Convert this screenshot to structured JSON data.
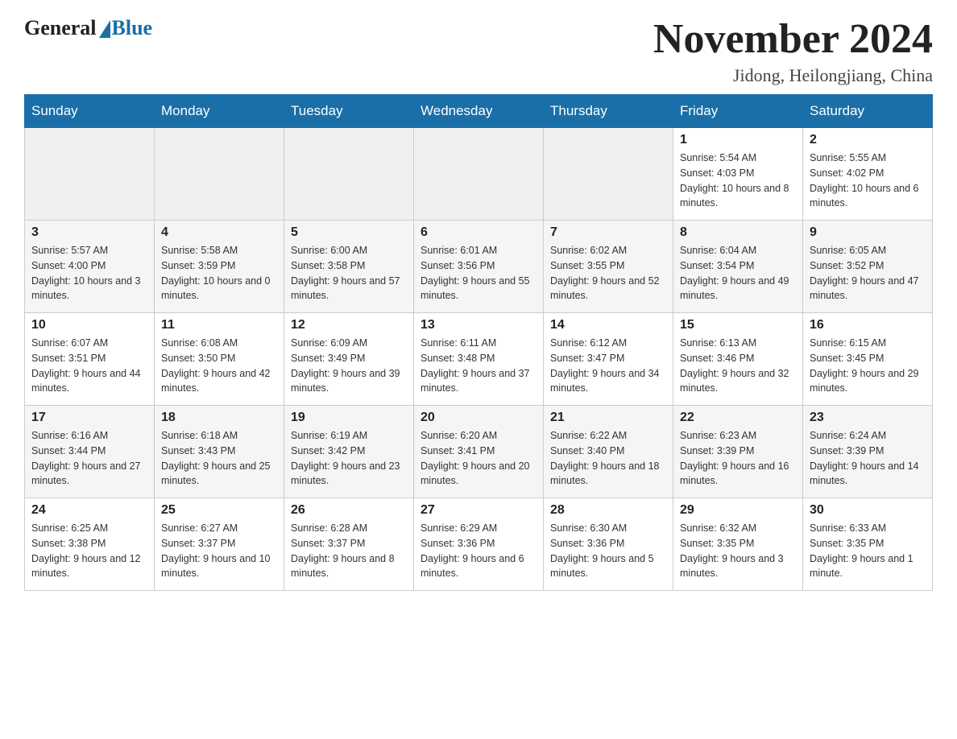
{
  "header": {
    "logo_general": "General",
    "logo_blue": "Blue",
    "month_title": "November 2024",
    "location": "Jidong, Heilongjiang, China"
  },
  "days_of_week": [
    "Sunday",
    "Monday",
    "Tuesday",
    "Wednesday",
    "Thursday",
    "Friday",
    "Saturday"
  ],
  "weeks": [
    [
      {
        "day": "",
        "sunrise": "",
        "sunset": "",
        "daylight": ""
      },
      {
        "day": "",
        "sunrise": "",
        "sunset": "",
        "daylight": ""
      },
      {
        "day": "",
        "sunrise": "",
        "sunset": "",
        "daylight": ""
      },
      {
        "day": "",
        "sunrise": "",
        "sunset": "",
        "daylight": ""
      },
      {
        "day": "",
        "sunrise": "",
        "sunset": "",
        "daylight": ""
      },
      {
        "day": "1",
        "sunrise": "Sunrise: 5:54 AM",
        "sunset": "Sunset: 4:03 PM",
        "daylight": "Daylight: 10 hours and 8 minutes."
      },
      {
        "day": "2",
        "sunrise": "Sunrise: 5:55 AM",
        "sunset": "Sunset: 4:02 PM",
        "daylight": "Daylight: 10 hours and 6 minutes."
      }
    ],
    [
      {
        "day": "3",
        "sunrise": "Sunrise: 5:57 AM",
        "sunset": "Sunset: 4:00 PM",
        "daylight": "Daylight: 10 hours and 3 minutes."
      },
      {
        "day": "4",
        "sunrise": "Sunrise: 5:58 AM",
        "sunset": "Sunset: 3:59 PM",
        "daylight": "Daylight: 10 hours and 0 minutes."
      },
      {
        "day": "5",
        "sunrise": "Sunrise: 6:00 AM",
        "sunset": "Sunset: 3:58 PM",
        "daylight": "Daylight: 9 hours and 57 minutes."
      },
      {
        "day": "6",
        "sunrise": "Sunrise: 6:01 AM",
        "sunset": "Sunset: 3:56 PM",
        "daylight": "Daylight: 9 hours and 55 minutes."
      },
      {
        "day": "7",
        "sunrise": "Sunrise: 6:02 AM",
        "sunset": "Sunset: 3:55 PM",
        "daylight": "Daylight: 9 hours and 52 minutes."
      },
      {
        "day": "8",
        "sunrise": "Sunrise: 6:04 AM",
        "sunset": "Sunset: 3:54 PM",
        "daylight": "Daylight: 9 hours and 49 minutes."
      },
      {
        "day": "9",
        "sunrise": "Sunrise: 6:05 AM",
        "sunset": "Sunset: 3:52 PM",
        "daylight": "Daylight: 9 hours and 47 minutes."
      }
    ],
    [
      {
        "day": "10",
        "sunrise": "Sunrise: 6:07 AM",
        "sunset": "Sunset: 3:51 PM",
        "daylight": "Daylight: 9 hours and 44 minutes."
      },
      {
        "day": "11",
        "sunrise": "Sunrise: 6:08 AM",
        "sunset": "Sunset: 3:50 PM",
        "daylight": "Daylight: 9 hours and 42 minutes."
      },
      {
        "day": "12",
        "sunrise": "Sunrise: 6:09 AM",
        "sunset": "Sunset: 3:49 PM",
        "daylight": "Daylight: 9 hours and 39 minutes."
      },
      {
        "day": "13",
        "sunrise": "Sunrise: 6:11 AM",
        "sunset": "Sunset: 3:48 PM",
        "daylight": "Daylight: 9 hours and 37 minutes."
      },
      {
        "day": "14",
        "sunrise": "Sunrise: 6:12 AM",
        "sunset": "Sunset: 3:47 PM",
        "daylight": "Daylight: 9 hours and 34 minutes."
      },
      {
        "day": "15",
        "sunrise": "Sunrise: 6:13 AM",
        "sunset": "Sunset: 3:46 PM",
        "daylight": "Daylight: 9 hours and 32 minutes."
      },
      {
        "day": "16",
        "sunrise": "Sunrise: 6:15 AM",
        "sunset": "Sunset: 3:45 PM",
        "daylight": "Daylight: 9 hours and 29 minutes."
      }
    ],
    [
      {
        "day": "17",
        "sunrise": "Sunrise: 6:16 AM",
        "sunset": "Sunset: 3:44 PM",
        "daylight": "Daylight: 9 hours and 27 minutes."
      },
      {
        "day": "18",
        "sunrise": "Sunrise: 6:18 AM",
        "sunset": "Sunset: 3:43 PM",
        "daylight": "Daylight: 9 hours and 25 minutes."
      },
      {
        "day": "19",
        "sunrise": "Sunrise: 6:19 AM",
        "sunset": "Sunset: 3:42 PM",
        "daylight": "Daylight: 9 hours and 23 minutes."
      },
      {
        "day": "20",
        "sunrise": "Sunrise: 6:20 AM",
        "sunset": "Sunset: 3:41 PM",
        "daylight": "Daylight: 9 hours and 20 minutes."
      },
      {
        "day": "21",
        "sunrise": "Sunrise: 6:22 AM",
        "sunset": "Sunset: 3:40 PM",
        "daylight": "Daylight: 9 hours and 18 minutes."
      },
      {
        "day": "22",
        "sunrise": "Sunrise: 6:23 AM",
        "sunset": "Sunset: 3:39 PM",
        "daylight": "Daylight: 9 hours and 16 minutes."
      },
      {
        "day": "23",
        "sunrise": "Sunrise: 6:24 AM",
        "sunset": "Sunset: 3:39 PM",
        "daylight": "Daylight: 9 hours and 14 minutes."
      }
    ],
    [
      {
        "day": "24",
        "sunrise": "Sunrise: 6:25 AM",
        "sunset": "Sunset: 3:38 PM",
        "daylight": "Daylight: 9 hours and 12 minutes."
      },
      {
        "day": "25",
        "sunrise": "Sunrise: 6:27 AM",
        "sunset": "Sunset: 3:37 PM",
        "daylight": "Daylight: 9 hours and 10 minutes."
      },
      {
        "day": "26",
        "sunrise": "Sunrise: 6:28 AM",
        "sunset": "Sunset: 3:37 PM",
        "daylight": "Daylight: 9 hours and 8 minutes."
      },
      {
        "day": "27",
        "sunrise": "Sunrise: 6:29 AM",
        "sunset": "Sunset: 3:36 PM",
        "daylight": "Daylight: 9 hours and 6 minutes."
      },
      {
        "day": "28",
        "sunrise": "Sunrise: 6:30 AM",
        "sunset": "Sunset: 3:36 PM",
        "daylight": "Daylight: 9 hours and 5 minutes."
      },
      {
        "day": "29",
        "sunrise": "Sunrise: 6:32 AM",
        "sunset": "Sunset: 3:35 PM",
        "daylight": "Daylight: 9 hours and 3 minutes."
      },
      {
        "day": "30",
        "sunrise": "Sunrise: 6:33 AM",
        "sunset": "Sunset: 3:35 PM",
        "daylight": "Daylight: 9 hours and 1 minute."
      }
    ]
  ]
}
